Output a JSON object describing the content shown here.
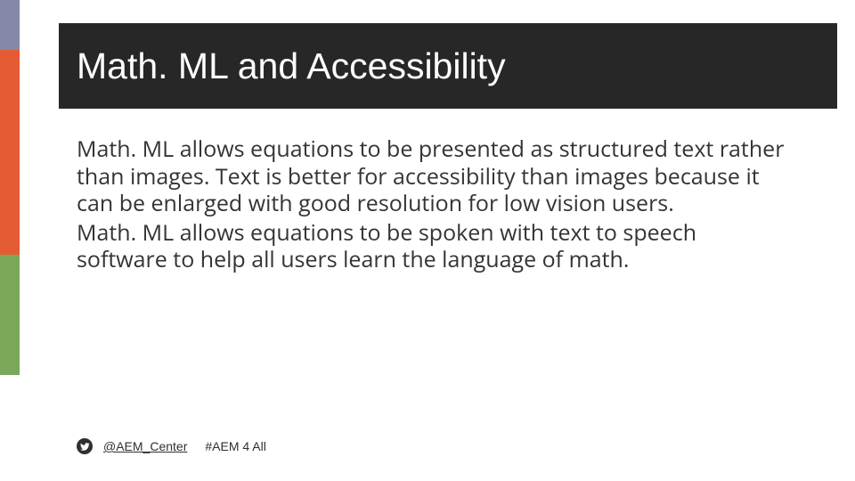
{
  "title": "Math. ML and Accessibility",
  "paragraphs": [
    "Math. ML allows equations to be presented as structured text rather than images. Text is better for accessibility than images because it can be enlarged with good resolution for low vision users.",
    "Math. ML allows equations to be spoken with text to speech software to help all users learn the language of math."
  ],
  "footer": {
    "handle": "@AEM_Center",
    "hashtag": "#AEM 4 All"
  },
  "sidebar_colors": [
    "#8589a7",
    "#e45c34",
    "#79a85a",
    "#ffffff"
  ]
}
